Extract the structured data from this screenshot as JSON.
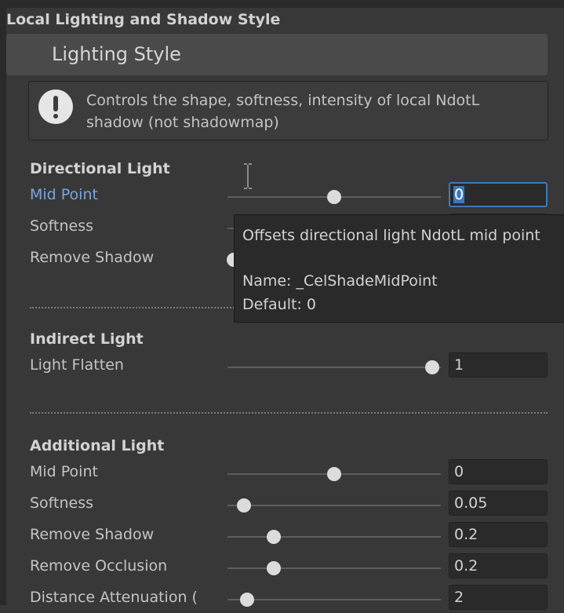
{
  "section_title": "Local Lighting and Shadow Style",
  "lighting_header": "Lighting Style",
  "help": {
    "icon": "warning-icon",
    "text": "Controls the shape, softness, intensity of local NdotL shadow (not shadowmap)"
  },
  "directional": {
    "title": "Directional Light",
    "mid_point": {
      "label": "Mid Point",
      "value": "0",
      "slider": 0.5
    },
    "softness": {
      "label": "Softness"
    },
    "remove_shadow": {
      "label": "Remove Shadow"
    }
  },
  "tooltip": {
    "line1": "Offsets directional light NdotL mid point",
    "line2": "Name: _CelShadeMidPoint",
    "line3": "Default: 0"
  },
  "indirect": {
    "title": "Indirect Light",
    "light_flatten": {
      "label": "Light Flatten",
      "value": "1",
      "slider": 1.0
    }
  },
  "additional": {
    "title": "Additional Light",
    "mid_point": {
      "label": "Mid Point",
      "value": "0",
      "slider": 0.5
    },
    "softness": {
      "label": "Softness",
      "value": "0.05",
      "slider": 0.08
    },
    "remove_shadow": {
      "label": "Remove Shadow",
      "value": "0.2",
      "slider": 0.22
    },
    "remove_occlusion": {
      "label": "Remove Occlusion",
      "value": "0.2",
      "slider": 0.22
    },
    "distance_attenuation": {
      "label": "Distance Attenuation (",
      "value": "2",
      "slider": 0.09
    }
  },
  "colors": {
    "accent": "#3a79bb",
    "label_active": "#7ba4e0",
    "panel_bg": "#383838",
    "field_bg": "#2a2a2a"
  }
}
